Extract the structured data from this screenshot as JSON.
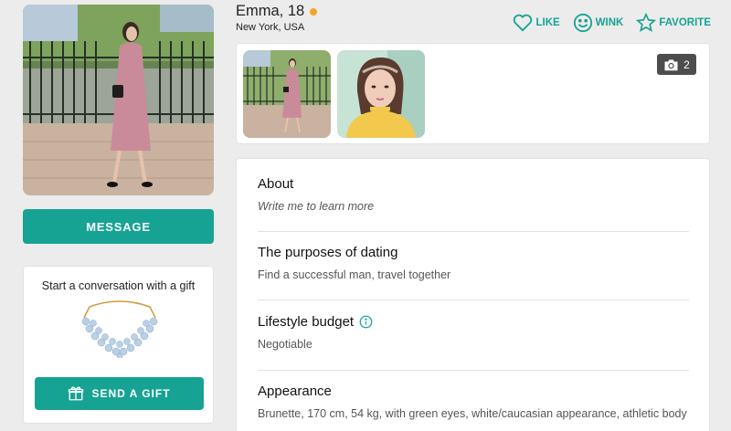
{
  "profile": {
    "name": "Emma, 18",
    "location": "New York, USA"
  },
  "actions": {
    "like": "LIKE",
    "wink": "WINK",
    "favorite": "FAVORITE"
  },
  "buttons": {
    "message": "MESSAGE",
    "send_gift": "SEND A GIFT"
  },
  "gift": {
    "title": "Start a conversation with a gift"
  },
  "photos": {
    "count": "2"
  },
  "sections": [
    {
      "title": "About",
      "text": "Write me to learn more"
    },
    {
      "title": "The purposes of dating",
      "text": "Find a successful man, travel together"
    },
    {
      "title": "Lifestyle budget",
      "text": "Negotiable"
    },
    {
      "title": "Appearance",
      "text": "Brunette, 170 cm, 54 kg, with green eyes, white/caucasian appearance, athletic body"
    }
  ],
  "colors": {
    "accent": "#16a393",
    "online": "#f5a623",
    "background": "#ececec"
  },
  "icons": [
    "heart-icon",
    "smile-icon",
    "star-icon",
    "camera-icon",
    "gift-icon",
    "info-icon"
  ]
}
